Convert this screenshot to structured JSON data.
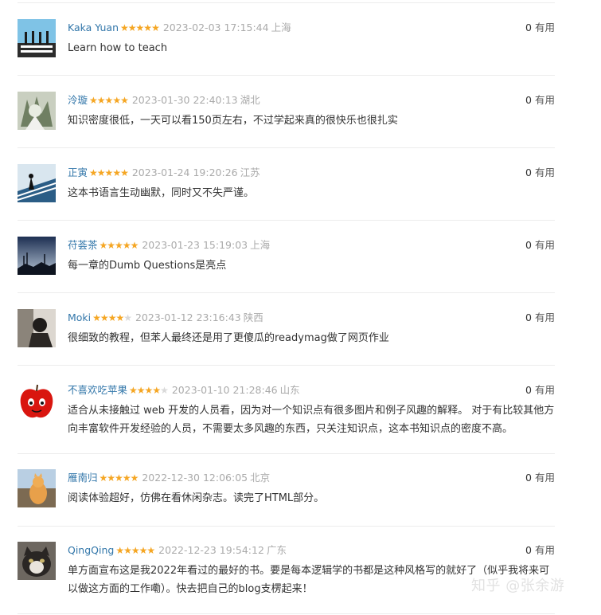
{
  "reviews": [
    {
      "user": "Kaka Yuan",
      "stars": 5,
      "time": "2023-02-03 17:15:44",
      "loc": "上海",
      "votes": "0",
      "vote_label": "有用",
      "text": "Learn how to teach"
    },
    {
      "user": "泠璇",
      "stars": 5,
      "time": "2023-01-30 22:40:13",
      "loc": "湖北",
      "votes": "0",
      "vote_label": "有用",
      "text": "知识密度很低，一天可以看150页左右，不过学起来真的很快乐也很扎实"
    },
    {
      "user": "正寅",
      "stars": 5,
      "time": "2023-01-24 19:20:26",
      "loc": "江苏",
      "votes": "0",
      "vote_label": "有用",
      "text": "这本书语言生动幽默，同时又不失严谨。"
    },
    {
      "user": "苻荟茶",
      "stars": 5,
      "time": "2023-01-23 15:19:03",
      "loc": "上海",
      "votes": "0",
      "vote_label": "有用",
      "text": "每一章的Dumb Questions是亮点"
    },
    {
      "user": "Moki",
      "stars": 4,
      "time": "2023-01-12 23:16:43",
      "loc": "陕西",
      "votes": "0",
      "vote_label": "有用",
      "text": "很细致的教程，但苯人最终还是用了更傻瓜的readymag做了网页作业"
    },
    {
      "user": "不喜欢吃苹果",
      "stars": 4,
      "time": "2023-01-10 21:28:46",
      "loc": "山东",
      "votes": "0",
      "vote_label": "有用",
      "text_lines": [
        "适合从未接触过 web 开发的人员看，因为对一个知识点有很多图片和例子风趣的解释。 对于有比较其他方",
        "向丰富软件开发经验的人员，不需要太多风趣的东西，只关注知识点，这本书知识点的密度不高。"
      ]
    },
    {
      "user": "雁南归",
      "stars": 5,
      "time": "2022-12-30 12:06:05",
      "loc": "北京",
      "votes": "0",
      "vote_label": "有用",
      "text": "阅读体验超好，仿佛在看休闲杂志。读完了HTML部分。"
    },
    {
      "user": "QingQing",
      "stars": 5,
      "time": "2022-12-23 19:54:12",
      "loc": "广东",
      "votes": "0",
      "vote_label": "有用",
      "text_lines": [
        "单方面宣布这是我2022年看过的最好的书。要是每本逻辑学的书都是这种风格写的就好了（似乎我将来可",
        "以做这方面的工作嘞）。快去把自己的blog支楞起来！"
      ]
    }
  ],
  "watermark": "知乎 @张余游",
  "colors": {
    "username": "#3377aa",
    "star": "#f5a623",
    "star_empty": "#d9d9d9",
    "meta": "#aaaaaa",
    "divider": "#ececec"
  }
}
